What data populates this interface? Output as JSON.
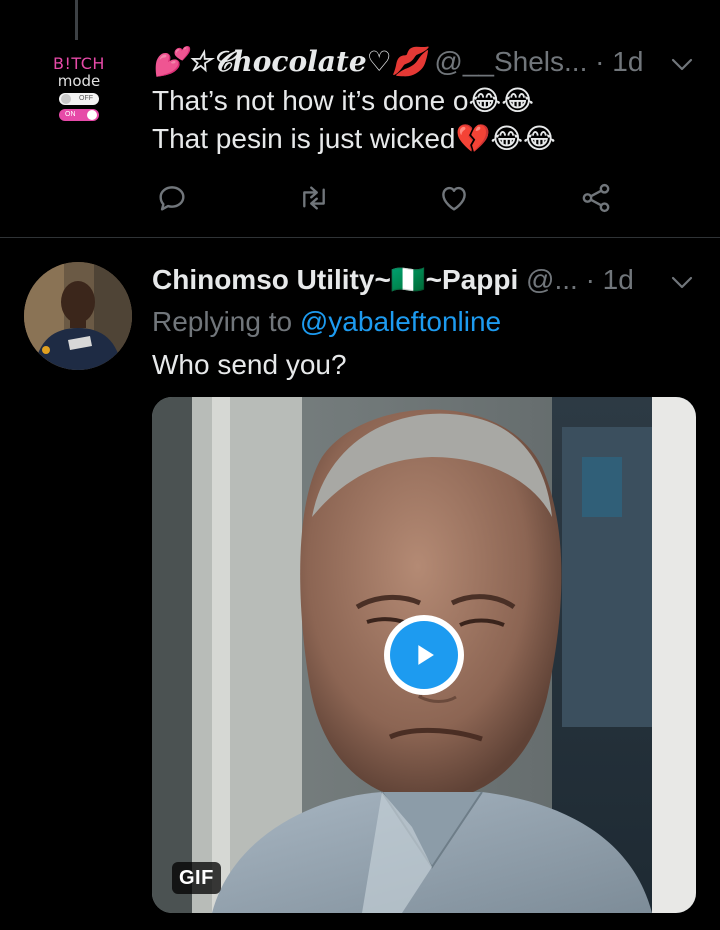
{
  "tweets": [
    {
      "display_name": "💕☆𝒞hocolate♡💋",
      "handle": "@__Shels...",
      "time": "· 1d",
      "lines": [
        "That’s not how it’s done o😂😂",
        "That pesin is just wicked💔😂😂"
      ],
      "avatar": {
        "word1": "B!TCH",
        "word2": "mode",
        "toggle_off_label": "OFF",
        "toggle_on_label": "ON"
      },
      "actions": [
        "reply-icon",
        "retweet-icon",
        "like-icon",
        "share-icon"
      ]
    },
    {
      "display_name": "Chinomso Utility~🇳🇬~Pappi",
      "handle": "@...",
      "time": "· 1d",
      "replying_prefix": "Replying to",
      "replying_mention": "@yabaleftonline",
      "body": "Who send you?",
      "media": {
        "type": "gif",
        "badge": "GIF",
        "play_icon": "play-icon"
      },
      "avatar_icon": "user-avatar"
    }
  ],
  "colors": {
    "background": "#000000",
    "text": "#e7e9ea",
    "secondary": "#71767b",
    "accent": "#1d9bf0",
    "divider": "#2f3336"
  }
}
